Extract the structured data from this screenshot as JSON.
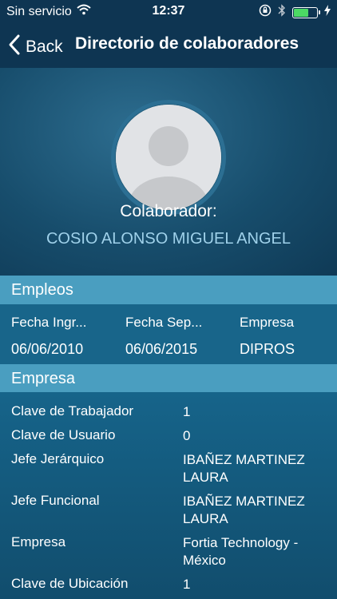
{
  "status_bar": {
    "carrier": "Sin servicio",
    "time": "12:37",
    "battery_level": 0.65
  },
  "nav": {
    "back_label": "Back",
    "title": "Directorio de colaboradores"
  },
  "profile": {
    "label": "Colaborador:",
    "name": "COSIO ALONSO MIGUEL ANGEL"
  },
  "empleos": {
    "header": "Empleos",
    "columns": [
      "Fecha Ingr...",
      "Fecha Sep...",
      "Empresa"
    ],
    "values": [
      "06/06/2010",
      "06/06/2015",
      "DIPROS"
    ]
  },
  "empresa": {
    "header": "Empresa",
    "rows": [
      {
        "key": "Clave de Trabajador",
        "value": "1"
      },
      {
        "key": "Clave de Usuario",
        "value": "0"
      },
      {
        "key": "Jefe Jerárquico",
        "value": "IBAÑEZ MARTINEZ LAURA"
      },
      {
        "key": "Jefe Funcional",
        "value": "IBAÑEZ MARTINEZ LAURA"
      },
      {
        "key": "Empresa",
        "value": "Fortia Technology - México"
      },
      {
        "key": "Clave de Ubicación",
        "value": "1"
      }
    ]
  },
  "colors": {
    "navbar": "#0e3552",
    "section_header": "#4a9ec0",
    "name_accent": "#9fd1ea"
  }
}
